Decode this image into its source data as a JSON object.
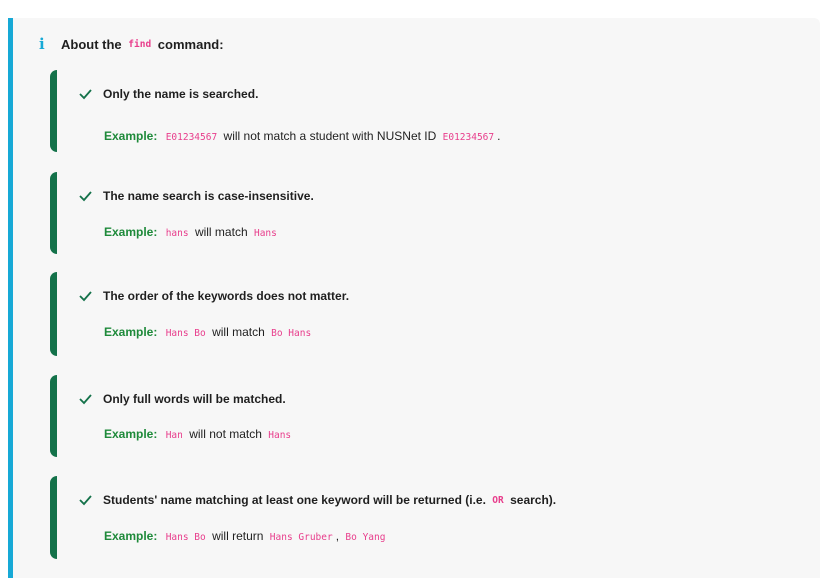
{
  "header": {
    "prefix": "About the",
    "command": "find",
    "suffix": "command:"
  },
  "tips": [
    {
      "title": "Only the name is searched.",
      "example_label": "Example:",
      "parts": [
        {
          "code": "E01234567"
        },
        {
          "text": "will not match a student with NUSNet ID"
        },
        {
          "code": "E01234567"
        },
        {
          "text": "."
        }
      ]
    },
    {
      "title": "The name search is case-insensitive.",
      "example_label": "Example:",
      "parts": [
        {
          "code": "hans"
        },
        {
          "text": "will match"
        },
        {
          "code": "Hans"
        }
      ]
    },
    {
      "title": "The order of the keywords does not matter.",
      "example_label": "Example:",
      "parts": [
        {
          "code": "Hans Bo"
        },
        {
          "text": "will match"
        },
        {
          "code": "Bo Hans"
        }
      ]
    },
    {
      "title": "Only full words will be matched.",
      "example_label": "Example:",
      "parts": [
        {
          "code": "Han"
        },
        {
          "text": "will not match"
        },
        {
          "code": "Hans"
        }
      ]
    },
    {
      "title_before": "Students' name matching at least one keyword will be returned (i.e.",
      "title_code": "OR",
      "title_after": "search).",
      "example_label": "Example:",
      "parts": [
        {
          "code": "Hans Bo"
        },
        {
          "text": "will return"
        },
        {
          "code": "Hans Gruber"
        },
        {
          "text": ","
        },
        {
          "code": "Bo Yang"
        }
      ]
    }
  ],
  "colors": {
    "info_accent": "#17a9d6",
    "tip_accent": "#14724a",
    "example_label": "#1e8a3a",
    "code": "#e83e8c"
  },
  "icons": {
    "info": "info-icon",
    "check": "check-icon"
  }
}
